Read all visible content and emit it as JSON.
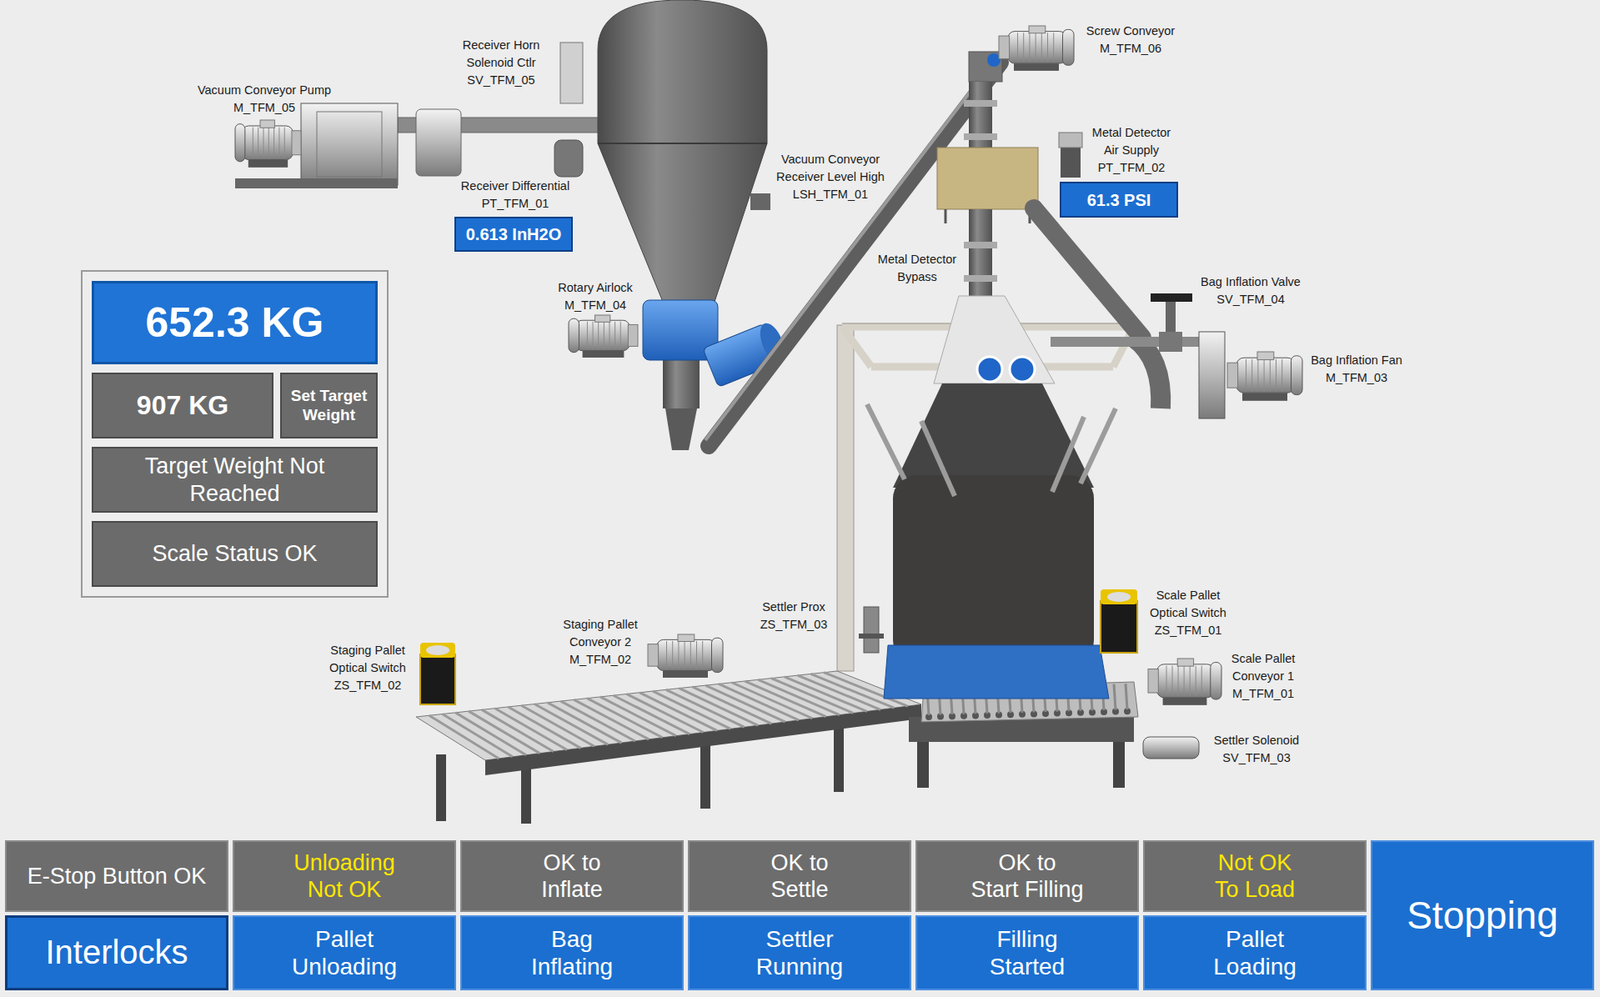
{
  "weigh_panel": {
    "weight": "652.3 KG",
    "target": "907 KG",
    "set_target": "Set Target Weight",
    "target_status": "Target Weight Not Reached",
    "scale_status": "Scale Status OK"
  },
  "equipment": [
    {
      "lines": [
        "Vacuum Conveyor Pump",
        "M_TFM_05"
      ]
    },
    {
      "lines": [
        "Receiver Horn",
        "Solenoid Ctlr",
        "SV_TFM_05"
      ]
    },
    {
      "lines": [
        "Screw Conveyor",
        "M_TFM_06"
      ]
    },
    {
      "lines": [
        "Vacuum Conveyor",
        "Receiver Level High",
        "LSH_TFM_01"
      ]
    },
    {
      "lines": [
        "Metal Detector",
        "Bypass"
      ]
    },
    {
      "lines": [
        "Rotary Airlock",
        "M_TFM_04"
      ]
    },
    {
      "lines": [
        "Bag Inflation Valve",
        "SV_TFM_04"
      ]
    },
    {
      "lines": [
        "Bag Inflation Fan",
        "M_TFM_03"
      ]
    },
    {
      "lines": [
        "Settler Prox",
        "ZS_TFM_03"
      ]
    },
    {
      "lines": [
        "Staging Pallet",
        "Conveyor 2",
        "M_TFM_02"
      ]
    },
    {
      "lines": [
        "Scale Pallet",
        "Optical Switch",
        "ZS_TFM_01"
      ]
    },
    {
      "lines": [
        "Staging Pallet",
        "Optical Switch",
        "ZS_TFM_02"
      ]
    },
    {
      "lines": [
        "Scale Pallet",
        "Conveyor 1",
        "M_TFM_01"
      ]
    },
    {
      "lines": [
        "Settler Solenoid",
        "SV_TFM_03"
      ]
    }
  ],
  "readings": [
    {
      "lines": [
        "Receiver Differential",
        "PT_TFM_01"
      ],
      "value": "0.613 InH2O"
    },
    {
      "lines": [
        "Metal Detector",
        "Air Supply",
        "PT_TFM_02"
      ],
      "value": "61.3 PSI"
    }
  ],
  "interlocks": [
    {
      "lines": [
        "E-Stop Button OK"
      ],
      "ok": true
    },
    {
      "lines": [
        "Unloading",
        "Not OK"
      ],
      "ok": false
    },
    {
      "lines": [
        "OK to",
        "Inflate"
      ],
      "ok": true
    },
    {
      "lines": [
        "OK to",
        "Settle"
      ],
      "ok": true
    },
    {
      "lines": [
        "OK to",
        "Start Filling"
      ],
      "ok": true
    },
    {
      "lines": [
        "Not OK",
        "To Load"
      ],
      "ok": false
    }
  ],
  "sequence": [
    {
      "lines": [
        "Interlocks"
      ],
      "selected": true
    },
    {
      "lines": [
        "Pallet",
        "Unloading"
      ],
      "selected": false
    },
    {
      "lines": [
        "Bag",
        "Inflating"
      ],
      "selected": false
    },
    {
      "lines": [
        "Settler",
        "Running"
      ],
      "selected": false
    },
    {
      "lines": [
        "Filling",
        "Started"
      ],
      "selected": false
    },
    {
      "lines": [
        "Pallet",
        "Loading"
      ],
      "selected": false
    }
  ],
  "state": "Stopping"
}
